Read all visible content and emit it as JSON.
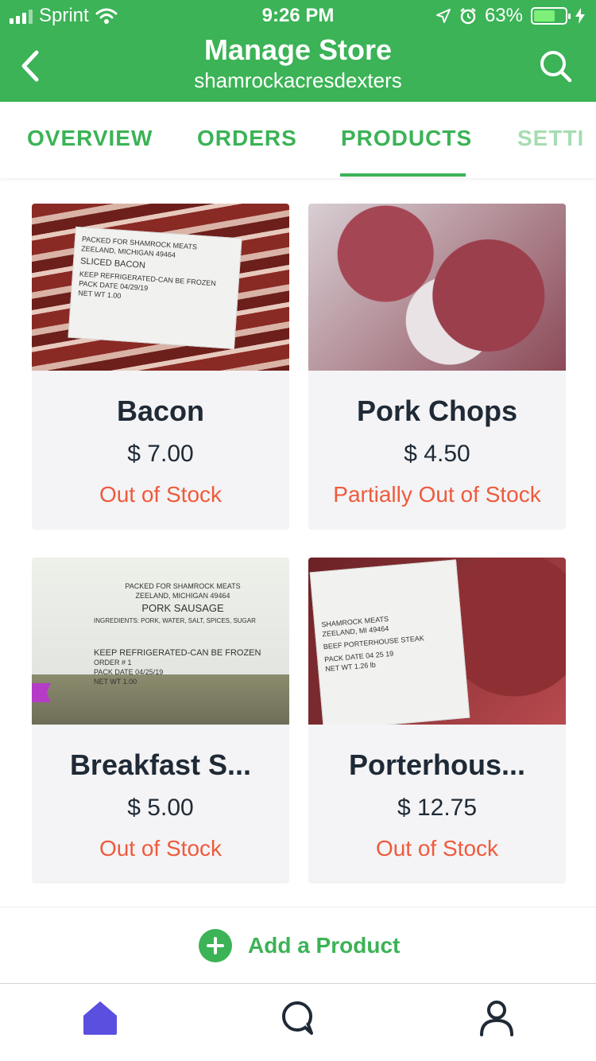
{
  "status_bar": {
    "carrier": "Sprint",
    "time": "9:26 PM",
    "battery": "63%"
  },
  "header": {
    "title": "Manage Store",
    "subtitle": "shamrockacresdexters"
  },
  "tabs": [
    {
      "label": "OVERVIEW"
    },
    {
      "label": "ORDERS"
    },
    {
      "label": "PRODUCTS",
      "active": true
    },
    {
      "label": "SETTI"
    }
  ],
  "products": [
    {
      "name": "Bacon",
      "price": "$ 7.00",
      "stock": "Out of Stock",
      "label": [
        "PACKED FOR SHAMROCK MEATS",
        "ZEELAND, MICHIGAN 49464",
        "SLICED BACON",
        "KEEP REFRIGERATED-CAN BE FROZEN",
        "PACK DATE 04/29/19",
        "NET WT 1.00"
      ]
    },
    {
      "name": "Pork Chops",
      "price": "$ 4.50",
      "stock": "Partially Out of Stock"
    },
    {
      "name": "Breakfast S...",
      "price": "$ 5.00",
      "stock": "Out of Stock",
      "label": [
        "PACKED FOR SHAMROCK MEATS",
        "ZEELAND, MICHIGAN 49464",
        "PORK SAUSAGE",
        "INGREDIENTS: PORK, WATER, SALT, SPICES, SUGAR",
        "KEEP REFRIGERATED-CAN BE FROZEN",
        "ORDER # 1",
        "PACK DATE 04/25/19",
        "NET WT 1.00"
      ]
    },
    {
      "name": "Porterhous...",
      "price": "$ 12.75",
      "stock": "Out of Stock",
      "label": [
        "SHAMROCK MEATS",
        "ZEELAND, MI 49464",
        "BEEF PORTERHOUSE STEAK",
        "PACK DATE 04 25 19",
        "NET WT 1.26 lb"
      ]
    }
  ],
  "add_product_label": "Add a Product",
  "colors": {
    "brand": "#3bb356",
    "alert": "#ef5a3c",
    "text": "#1f2a36",
    "nav_active": "#5b4fe0"
  },
  "icons": {
    "back": "chevron-left-icon",
    "search": "search-icon",
    "home": "home-icon",
    "chat": "chat-icon",
    "user": "user-icon"
  }
}
